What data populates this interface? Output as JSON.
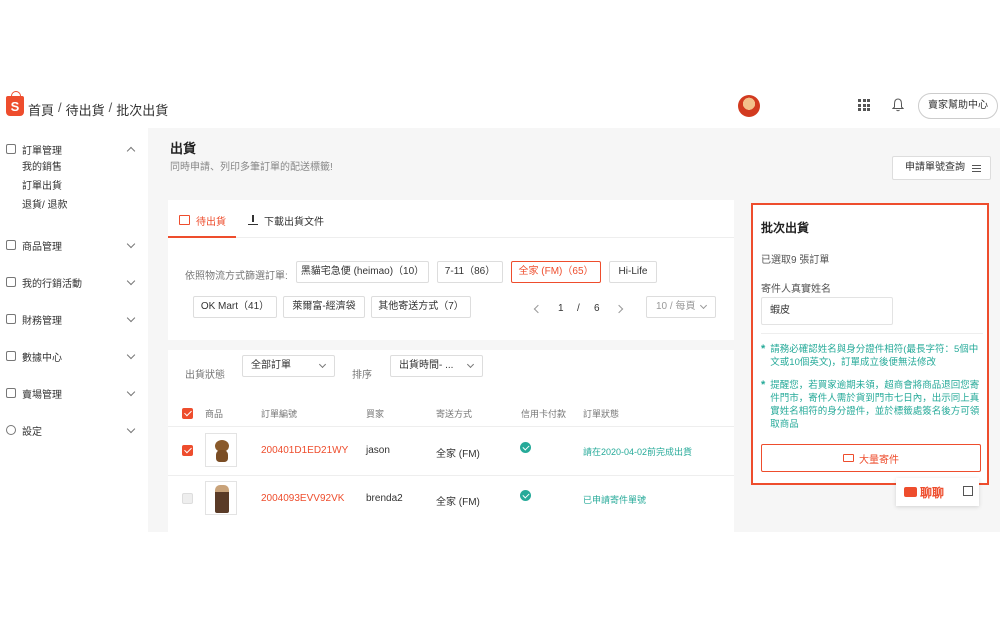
{
  "header": {
    "breadcrumb": [
      "首頁",
      "待出貨",
      "批次出貨"
    ],
    "help_label": "賣家幫助中心"
  },
  "sidebar": {
    "groups": [
      {
        "label": "訂單管理",
        "items": [
          "我的銷售",
          "訂單出貨",
          "退貨/ 退款"
        ]
      },
      {
        "label": "商品管理"
      },
      {
        "label": "我的行銷活動"
      },
      {
        "label": "財務管理"
      },
      {
        "label": "數據中心"
      },
      {
        "label": "賣場管理"
      },
      {
        "label": "設定"
      }
    ]
  },
  "page": {
    "title": "出貨",
    "subtitle": "同時申請、列印多筆訂單的配送標籤!",
    "tracking_button": "申請單號查詢"
  },
  "tabs": [
    {
      "label": "待出貨",
      "active": true
    },
    {
      "label": "下載出貨文件",
      "active": false
    }
  ],
  "filter": {
    "label": "依照物流方式篩選訂單:",
    "chips": [
      {
        "label": "黑貓宅急便 (heimao)（10）",
        "selected": false
      },
      {
        "label": "7-11（86）",
        "selected": false
      },
      {
        "label": "全家 (FM)（65）",
        "selected": true
      },
      {
        "label": "Hi-Life",
        "selected": false
      },
      {
        "label": "OK Mart（41）",
        "selected": false
      },
      {
        "label": "萊爾富-經濟袋",
        "selected": false
      },
      {
        "label": "其他寄送方式（7）",
        "selected": false
      }
    ]
  },
  "pagination": {
    "current": "1",
    "sep": "/",
    "total": "6",
    "per_page": "10 / 每頁"
  },
  "controls": {
    "status_label": "出貨狀態",
    "status_value": "全部訂單",
    "sort_label": "排序",
    "sort_value": "出貨時間- ..."
  },
  "table": {
    "columns": [
      "商品",
      "訂單編號",
      "買家",
      "寄送方式",
      "信用卡付款",
      "訂單狀態"
    ],
    "rows": [
      {
        "order_id": "200401D1ED21WY",
        "buyer": "jason",
        "shipping": "全家 (FM)",
        "status": "請在2020-04-02前完成出貨",
        "checked": true
      },
      {
        "order_id": "2004093EVV92VK",
        "buyer": "brenda2",
        "shipping": "全家 (FM)",
        "status": "已申請寄件單號",
        "checked": false
      }
    ]
  },
  "panel": {
    "title": "批次出貨",
    "selected_count": "已選取9 張訂單",
    "sender_label": "寄件人真實姓名",
    "sender_value": "蝦皮",
    "notice1": "請務必確認姓名與身分證件相符(最長字符：5個中文或10個英文)，訂單成立後便無法修改",
    "notice2": "提醒您，若買家逾期未領，超商會將商品退回您寄件門市，寄件人需於貨到門市七日內，出示同上真實姓名相符的身分證件，並於標籤處簽名後方可領取商品",
    "bulk_button": "大量寄件"
  },
  "chat": {
    "label": "聊聊"
  },
  "colors": {
    "accent": "#ee4d2d",
    "success": "#26aa99"
  }
}
